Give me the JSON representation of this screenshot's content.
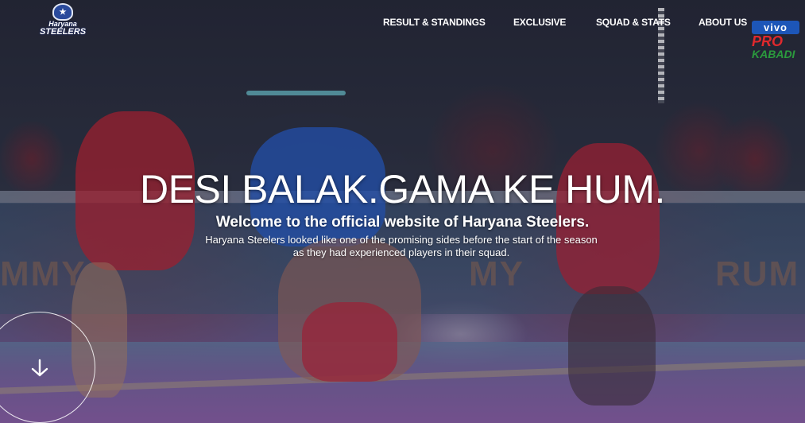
{
  "logo": {
    "line1": "Haryana",
    "line2": "STEELERS"
  },
  "nav": {
    "items": [
      {
        "label": "RESULT & STANDINGS"
      },
      {
        "label": "EXCLUSIVE"
      },
      {
        "label": "SQUAD & STATS"
      },
      {
        "label": "ABOUT US"
      }
    ]
  },
  "sponsor": {
    "vivo": "vivo",
    "pro": "PRO",
    "kabaddi": "KABADI"
  },
  "hero": {
    "headline": "DESI BALAK.GAMA KE HUM.",
    "subtitle": "Welcome to the official website of Haryana Steelers.",
    "description": "Haryana Steelers looked like one of the promising sides before the start of the season as they had experienced players in their squad."
  },
  "scroll": {
    "icon": "arrow-down-icon"
  },
  "colors": {
    "text": "#ffffff",
    "brand_blue": "#1d56b8",
    "jersey_red": "#c8233a"
  }
}
